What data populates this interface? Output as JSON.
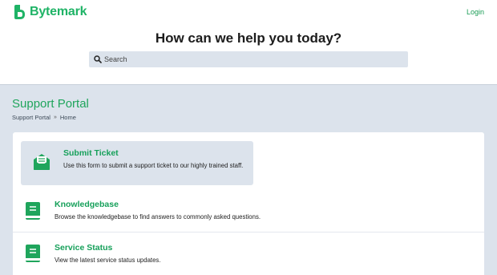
{
  "brand": {
    "name": "Bytemark",
    "color": "#1fb366"
  },
  "nav": {
    "login_label": "Login"
  },
  "hero": {
    "headline": "How can we help you today?"
  },
  "search": {
    "placeholder": "Search",
    "value": ""
  },
  "portal": {
    "title": "Support Portal",
    "breadcrumb": [
      "Support Portal",
      "»",
      "Home"
    ]
  },
  "items": [
    {
      "title": "Submit Ticket",
      "description": "Use this form to submit a support ticket to our highly trained staff.",
      "icon": "envelope-open-icon"
    },
    {
      "title": "Knowledgebase",
      "description": "Browse the knowledgebase to find answers to commonly asked questions.",
      "icon": "book-icon"
    },
    {
      "title": "Service Status",
      "description": "View the latest service status updates.",
      "icon": "book-icon"
    }
  ],
  "colors": {
    "accent": "#1fa55c",
    "page_bg": "#dce3ec",
    "panel_bg": "#ffffff"
  }
}
